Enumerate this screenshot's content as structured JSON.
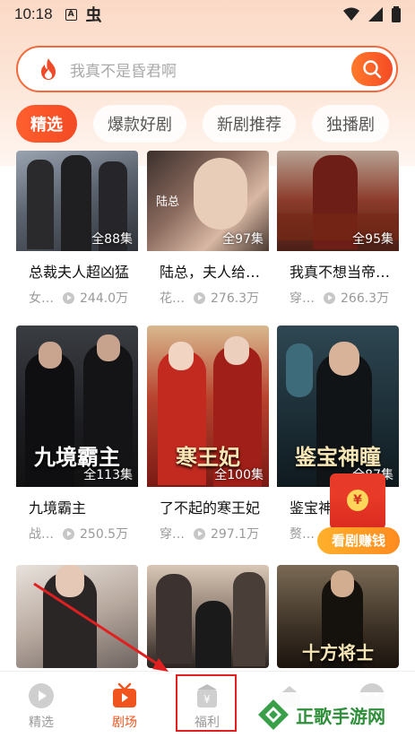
{
  "status_bar": {
    "time": "10:18",
    "icon_a": "A",
    "icon_b": "虫"
  },
  "search": {
    "placeholder": "我真不是昏君啊"
  },
  "tabs": [
    {
      "label": "精选",
      "active": true
    },
    {
      "label": "爆款好剧",
      "active": false
    },
    {
      "label": "新剧推荐",
      "active": false
    },
    {
      "label": "独播剧",
      "active": false
    }
  ],
  "cards": [
    {
      "title": "总裁夫人超凶猛",
      "episodes": "全88集",
      "genre": "女…",
      "views": "244.0万"
    },
    {
      "title": "陆总，夫人给…",
      "episodes": "全97集",
      "genre": "花…",
      "views": "276.3万"
    },
    {
      "title": "我真不想当帝…",
      "episodes": "全95集",
      "genre": "穿…",
      "views": "266.3万"
    },
    {
      "title": "九境霸主",
      "episodes": "全113集",
      "genre": "战…",
      "views": "250.5万",
      "poster_text": "九境霸主"
    },
    {
      "title": "了不起的寒王妃",
      "episodes": "全100集",
      "genre": "穿…",
      "views": "297.1万",
      "poster_text": "寒王妃"
    },
    {
      "title": "鉴宝神",
      "episodes": "全87集",
      "genre": "赘…",
      "views": "",
      "poster_text": "鉴宝神瞳"
    },
    {
      "title": "",
      "episodes": "",
      "genre": "",
      "views": ""
    },
    {
      "title": "",
      "episodes": "",
      "genre": "",
      "views": ""
    },
    {
      "title": "",
      "episodes": "",
      "genre": "",
      "views": "",
      "poster_text": "十方将士"
    }
  ],
  "red_envelope": {
    "coin": "¥",
    "label": "看剧赚钱"
  },
  "bottom_nav": [
    {
      "label": "精选",
      "icon": "play-circle-icon",
      "active": false
    },
    {
      "label": "剧场",
      "icon": "tv-icon",
      "active": true
    },
    {
      "label": "福利",
      "icon": "gift-icon",
      "active": false
    },
    {
      "label": "",
      "icon": "home-icon",
      "active": false
    },
    {
      "label": "",
      "icon": "profile-icon",
      "active": false
    }
  ],
  "watermark": {
    "text": "正歌手游网"
  },
  "colors": {
    "accent": "#f0541f",
    "search_border": "#f26a3c",
    "highlight_box": "#e02020"
  }
}
